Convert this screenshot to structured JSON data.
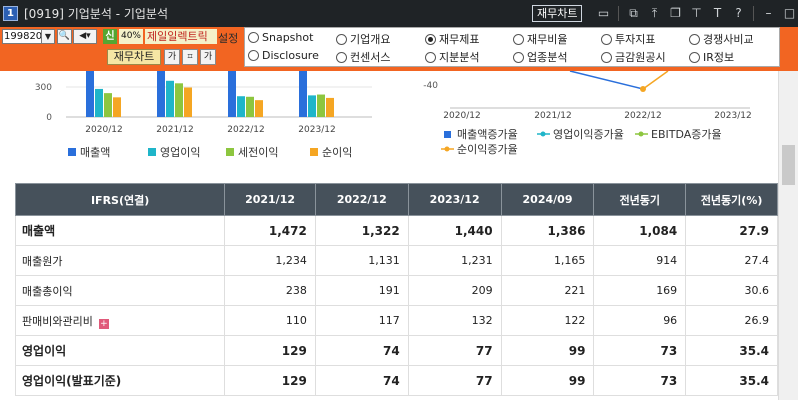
{
  "window": {
    "number": "1",
    "title": "[0919] 기업분석 - 기업분석",
    "chart_button": "재무차트",
    "icons": [
      "monitor-icon",
      "new-window-icon",
      "pin-top-icon",
      "copy-icon",
      "pin-icon",
      "font-icon",
      "help-icon",
      "minimize-icon",
      "maximize-icon",
      "close-icon"
    ]
  },
  "toolbar": {
    "code": "199820",
    "shin_label": "신",
    "ratio": "40%",
    "company": "제일일렉트릭",
    "setting_label": "설정",
    "fin_chart_button": "재무차트",
    "small_buttons": [
      "가",
      "",
      "가"
    ],
    "radios": [
      {
        "label": "Snapshot",
        "checked": false
      },
      {
        "label": "기업개요",
        "checked": false
      },
      {
        "label": "재무제표",
        "checked": true
      },
      {
        "label": "재무비율",
        "checked": false
      },
      {
        "label": "투자지표",
        "checked": false
      },
      {
        "label": "경쟁사비교",
        "checked": false
      },
      {
        "label": "Disclosure",
        "checked": false
      },
      {
        "label": "컨센서스",
        "checked": false
      },
      {
        "label": "지분분석",
        "checked": false
      },
      {
        "label": "업종분석",
        "checked": false
      },
      {
        "label": "금감원공시",
        "checked": false
      },
      {
        "label": "IR정보",
        "checked": false
      }
    ]
  },
  "chart_data": [
    {
      "type": "bar",
      "categories": [
        "2020/12",
        "2021/12",
        "2022/12",
        "2023/12"
      ],
      "ytick_labels": [
        "0",
        "300"
      ],
      "ylim": [
        0,
        520
      ],
      "series": [
        {
          "name": "매출액",
          "color": "#2a6fdb",
          "values": [
            1500,
            1472,
            1322,
            1440
          ]
        },
        {
          "name": "영업이익",
          "color": "#1fb5c9",
          "values": [
            100,
            129,
            74,
            77
          ]
        },
        {
          "name": "세전이익",
          "color": "#8dc63f",
          "values": [
            85,
            120,
            72,
            80
          ]
        },
        {
          "name": "순이익",
          "color": "#f5a623",
          "values": [
            70,
            105,
            60,
            68
          ]
        }
      ],
      "legend": "bottom"
    },
    {
      "type": "line",
      "categories": [
        "2020/12",
        "2021/12",
        "2022/12",
        "2023/12"
      ],
      "ytick_labels": [
        "-40"
      ],
      "series": [
        {
          "name": "매출액증가율",
          "color": "#2a6fdb"
        },
        {
          "name": "영업이익증가율",
          "color": "#1fb5c9"
        },
        {
          "name": "EBITDA증가율",
          "color": "#8dc63f"
        },
        {
          "name": "순이익증가율",
          "color": "#f5a623"
        }
      ],
      "legend": "bottom"
    }
  ],
  "table": {
    "headers": [
      "IFRS(연결)",
      "2021/12",
      "2022/12",
      "2023/12",
      "2024/09",
      "전년동기",
      "전년동기(%)"
    ],
    "rows": [
      {
        "label": "매출액",
        "bold": true,
        "values": [
          "1,472",
          "1,322",
          "1,440",
          "1,386",
          "1,084",
          "27.9"
        ]
      },
      {
        "label": "매출원가",
        "bold": false,
        "values": [
          "1,234",
          "1,131",
          "1,231",
          "1,165",
          "914",
          "27.4"
        ]
      },
      {
        "label": "매출총이익",
        "bold": false,
        "values": [
          "238",
          "191",
          "209",
          "221",
          "169",
          "30.6"
        ]
      },
      {
        "label": "판매비와관리비",
        "bold": false,
        "expand": "+",
        "values": [
          "110",
          "117",
          "132",
          "122",
          "96",
          "26.9"
        ]
      },
      {
        "label": "영업이익",
        "bold": true,
        "values": [
          "129",
          "74",
          "77",
          "99",
          "73",
          "35.4"
        ]
      },
      {
        "label": "영업이익(발표기준)",
        "bold": true,
        "values": [
          "129",
          "74",
          "77",
          "99",
          "73",
          "35.4"
        ]
      }
    ]
  }
}
